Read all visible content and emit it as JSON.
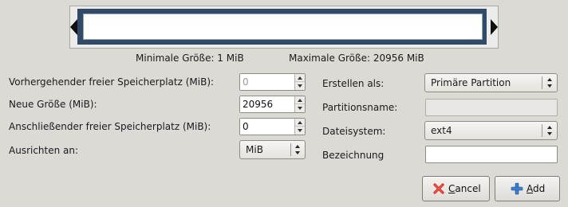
{
  "info": {
    "min_size": "Minimale Größe: 1 MiB",
    "max_size": "Maximale Größe: 20956 MiB"
  },
  "fields": {
    "preceding_label": "Vorhergehender freier Speicherplatz (MiB):",
    "preceding_value": "0",
    "new_size_label": "Neue Größe (MiB):",
    "new_size_value": "20956",
    "following_label": "Anschließender freier Speicherplatz (MiB):",
    "following_value": "0",
    "align_label": "Ausrichten an:",
    "align_value": "MiB"
  },
  "right": {
    "create_as_label": "Erstellen als:",
    "create_as_value": "Primäre Partition",
    "partition_name_label": "Partitionsname:",
    "partition_name_value": "",
    "filesystem_label": "Dateisystem:",
    "filesystem_value": "ext4",
    "label_label": "Bezeichnung",
    "label_value": ""
  },
  "buttons": {
    "cancel_mnemonic": "C",
    "cancel_rest": "ancel",
    "add_mnemonic": "A",
    "add_rest": "dd"
  },
  "icons": {
    "cancel": "red-x-icon",
    "add": "blue-plus-icon"
  },
  "colors": {
    "partition_bar": "#304a67",
    "cancel_icon": "#d42a1e",
    "add_icon": "#3d7fd1"
  }
}
